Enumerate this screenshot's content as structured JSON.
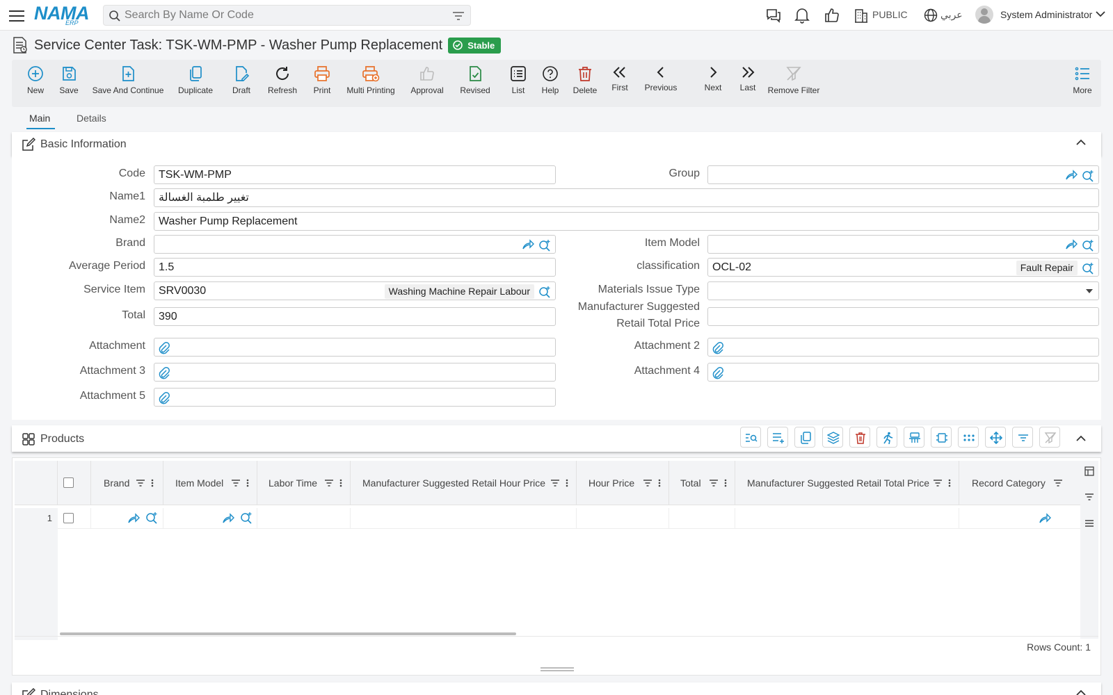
{
  "topbar": {
    "search_placeholder": "Search By Name Or Code",
    "branch_label": "PUBLIC",
    "language_label": "عربي",
    "user_name": "System Administrator",
    "brand_logo_text": "NAMA",
    "brand_logo_sub": "ERP"
  },
  "page": {
    "title": "Service Center Task: TSK-WM-PMP - Washer Pump Replacement",
    "status_badge": "Stable"
  },
  "toolbar": {
    "new": "New",
    "save": "Save",
    "save_continue": "Save And Continue",
    "duplicate": "Duplicate",
    "draft": "Draft",
    "refresh": "Refresh",
    "print": "Print",
    "multi_printing": "Multi Printing",
    "approval": "Approval",
    "revised": "Revised",
    "list": "List",
    "help": "Help",
    "delete": "Delete",
    "first": "First",
    "previous": "Previous",
    "next": "Next",
    "last": "Last",
    "remove_filter": "Remove Filter",
    "more": "More"
  },
  "tabs": {
    "main": "Main",
    "details": "Details"
  },
  "basic_info": {
    "title": "Basic Information",
    "labels": {
      "code": "Code",
      "group": "Group",
      "name1": "Name1",
      "name2": "Name2",
      "brand": "Brand",
      "item_model": "Item Model",
      "average_period": "Average Period",
      "classification": "classification",
      "service_item": "Service Item",
      "materials_issue_type": "Materials Issue Type",
      "total": "Total",
      "msrp_line1": "Manufacturer Suggested",
      "msrp_line2": "Retail Total Price",
      "attachment": "Attachment",
      "attachment2": "Attachment 2",
      "attachment3": "Attachment 3",
      "attachment4": "Attachment 4",
      "attachment5": "Attachment 5"
    },
    "values": {
      "code": "TSK-WM-PMP",
      "group": "",
      "name1": "تغيير طلمبة الغسالة",
      "name2": "Washer Pump Replacement",
      "brand": "",
      "item_model": "",
      "average_period": "1.5",
      "classification_code": "OCL-02",
      "classification_name": "Fault Repair",
      "service_item_code": "SRV0030",
      "service_item_name": "Washing Machine Repair Labour",
      "materials_issue_type": "",
      "total": "390",
      "msrp_total": ""
    }
  },
  "products": {
    "title": "Products",
    "columns": [
      "Brand",
      "Item Model",
      "Labor Time",
      "Manufacturer Suggested Retail Hour Price",
      "Hour Price",
      "Total",
      "Manufacturer Suggested Retail Total Price",
      "Record Category"
    ],
    "rows": [
      {
        "num": "1"
      }
    ],
    "rows_count": "Rows Count: 1"
  },
  "dimensions": {
    "title": "Dimensions"
  },
  "colors": {
    "accent": "#1d8ec9",
    "stable_badge": "#2a9d4d",
    "print_orange": "#e8712b",
    "delete_red": "#c0392b",
    "revised_green": "#2a8a45"
  }
}
